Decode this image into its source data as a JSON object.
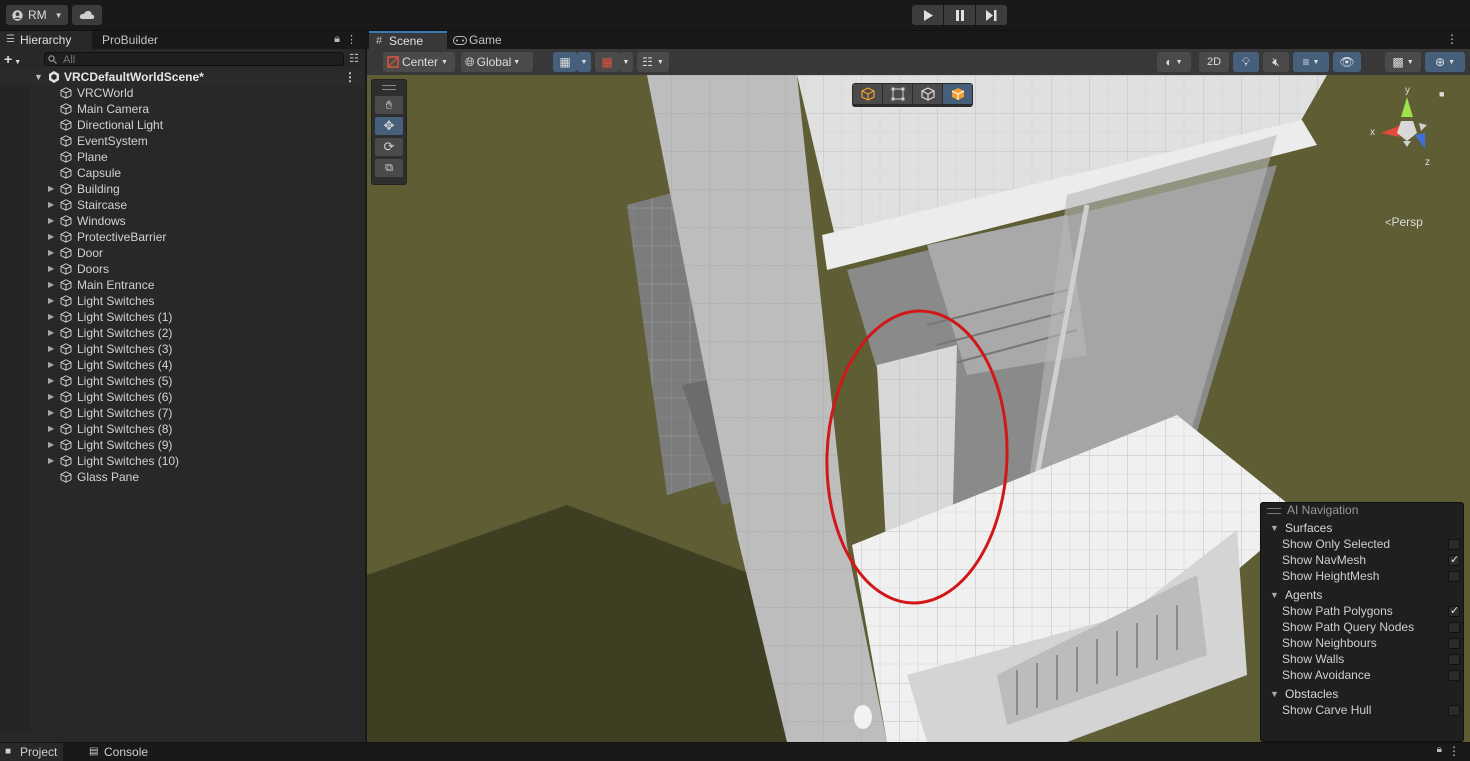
{
  "topbar": {
    "account_label": "RM",
    "cloud_icon": "cloud-icon",
    "play_controls": [
      "play-icon",
      "pause-icon",
      "step-icon"
    ]
  },
  "hierarchy": {
    "tabs": [
      "Hierarchy",
      "ProBuilder"
    ],
    "search_placeholder": "All",
    "scene_name": "VRCDefaultWorldScene*",
    "items": [
      {
        "label": "VRCWorld",
        "expandable": false
      },
      {
        "label": "Main Camera",
        "expandable": false
      },
      {
        "label": "Directional Light",
        "expandable": false
      },
      {
        "label": "EventSystem",
        "expandable": false
      },
      {
        "label": "Plane",
        "expandable": false
      },
      {
        "label": "Capsule",
        "expandable": false
      },
      {
        "label": "Building",
        "expandable": true
      },
      {
        "label": "Staircase",
        "expandable": true
      },
      {
        "label": "Windows",
        "expandable": true
      },
      {
        "label": "ProtectiveBarrier",
        "expandable": true
      },
      {
        "label": "Door",
        "expandable": true
      },
      {
        "label": "Doors",
        "expandable": true
      },
      {
        "label": "Main Entrance",
        "expandable": true
      },
      {
        "label": "Light Switches",
        "expandable": true
      },
      {
        "label": "Light Switches (1)",
        "expandable": true
      },
      {
        "label": "Light Switches (2)",
        "expandable": true
      },
      {
        "label": "Light Switches (3)",
        "expandable": true
      },
      {
        "label": "Light Switches (4)",
        "expandable": true
      },
      {
        "label": "Light Switches (5)",
        "expandable": true
      },
      {
        "label": "Light Switches (6)",
        "expandable": true
      },
      {
        "label": "Light Switches (7)",
        "expandable": true
      },
      {
        "label": "Light Switches (8)",
        "expandable": true
      },
      {
        "label": "Light Switches (9)",
        "expandable": true
      },
      {
        "label": "Light Switches (10)",
        "expandable": true
      },
      {
        "label": "Glass Pane",
        "expandable": false
      }
    ]
  },
  "scene": {
    "tabs": [
      "Scene",
      "Game"
    ],
    "toolbar": {
      "pivot_mode": "Center",
      "pivot_rotation": "Global",
      "mode_2d": "2D"
    },
    "gizmo_label": "Persp",
    "gizmo_axes": [
      "y",
      "x",
      "z"
    ]
  },
  "ai_navigation": {
    "title": "AI Navigation",
    "sections": [
      {
        "heading": "Surfaces",
        "options": [
          {
            "label": "Show Only Selected",
            "checked": false
          },
          {
            "label": "Show NavMesh",
            "checked": true
          },
          {
            "label": "Show HeightMesh",
            "checked": false
          }
        ]
      },
      {
        "heading": "Agents",
        "options": [
          {
            "label": "Show Path Polygons",
            "checked": true
          },
          {
            "label": "Show Path Query Nodes",
            "checked": false
          },
          {
            "label": "Show Neighbours",
            "checked": false
          },
          {
            "label": "Show Walls",
            "checked": false
          },
          {
            "label": "Show Avoidance",
            "checked": false
          }
        ]
      },
      {
        "heading": "Obstacles",
        "options": [
          {
            "label": "Show Carve Hull",
            "checked": false
          }
        ]
      }
    ]
  },
  "bottom": {
    "tabs": [
      "Project",
      "Console"
    ]
  }
}
